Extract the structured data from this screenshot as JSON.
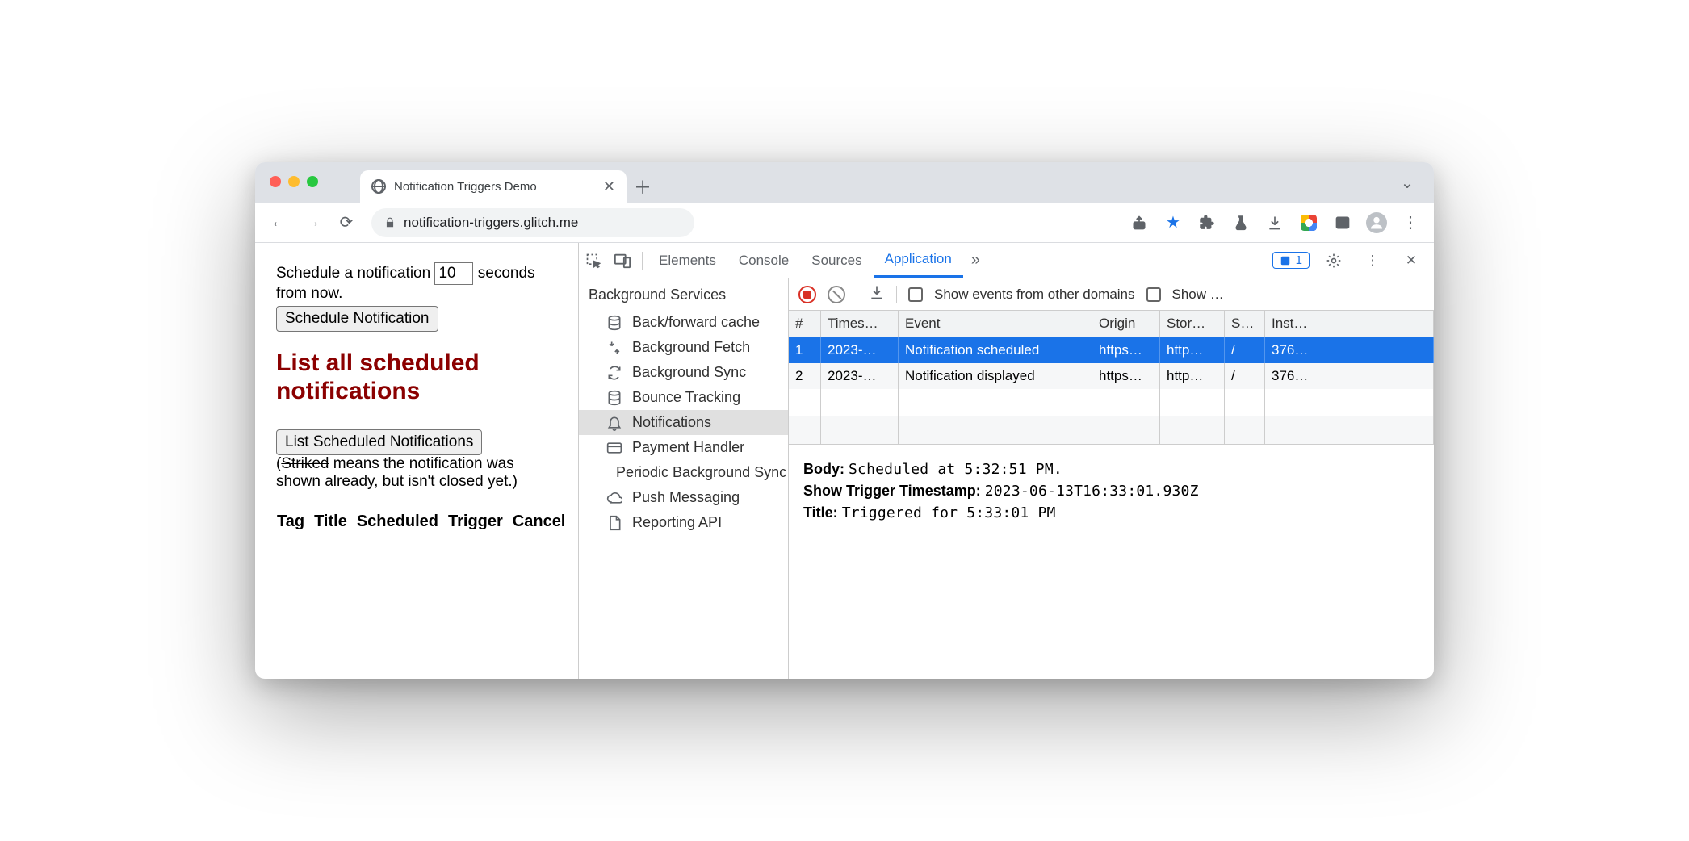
{
  "browser": {
    "tab_title": "Notification Triggers Demo",
    "url": "notification-triggers.glitch.me"
  },
  "page": {
    "schedule_text_1": "Schedule a notification",
    "schedule_input": "10",
    "schedule_text_2": "seconds from now.",
    "schedule_button": "Schedule Notification",
    "heading": "List all scheduled notifications",
    "list_button": "List Scheduled Notifications",
    "note_open": "(",
    "note_strike": "Striked",
    "note_rest": " means the notification was shown already, but isn't closed yet.)",
    "table_headers": [
      "Tag",
      "Title",
      "Scheduled",
      "Trigger",
      "Cancel"
    ]
  },
  "devtools": {
    "tabs": [
      "Elements",
      "Console",
      "Sources",
      "Application"
    ],
    "active_tab": "Application",
    "issues_count": "1",
    "sidebar": {
      "heading": "Background Services",
      "items": [
        {
          "icon": "db",
          "label": "Back/forward cache"
        },
        {
          "icon": "fetch",
          "label": "Background Fetch"
        },
        {
          "icon": "sync",
          "label": "Background Sync"
        },
        {
          "icon": "db",
          "label": "Bounce Tracking"
        },
        {
          "icon": "bell",
          "label": "Notifications",
          "selected": true
        },
        {
          "icon": "card",
          "label": "Payment Handler"
        },
        {
          "icon": "clock",
          "label": "Periodic Background Sync"
        },
        {
          "icon": "cloud",
          "label": "Push Messaging"
        },
        {
          "icon": "file",
          "label": "Reporting API"
        }
      ]
    },
    "toolbar": {
      "checkbox1_label": "Show events from other domains",
      "checkbox2_label": "Show …"
    },
    "grid": {
      "columns": [
        "#",
        "Times…",
        "Event",
        "Origin",
        "Stor…",
        "S…",
        "Inst…"
      ],
      "rows": [
        {
          "n": "1",
          "ts": "2023-…",
          "event": "Notification scheduled",
          "origin": "https…",
          "storage": "http…",
          "s": "/",
          "inst": "376…",
          "selected": true
        },
        {
          "n": "2",
          "ts": "2023-…",
          "event": "Notification displayed",
          "origin": "https…",
          "storage": "http…",
          "s": "/",
          "inst": "376…"
        }
      ]
    },
    "detail": {
      "body_label": "Body:",
      "body_value": "Scheduled at 5:32:51 PM.",
      "trigger_label": "Show Trigger Timestamp:",
      "trigger_value": "2023-06-13T16:33:01.930Z",
      "title_label": "Title:",
      "title_value": "Triggered for 5:33:01 PM"
    }
  }
}
